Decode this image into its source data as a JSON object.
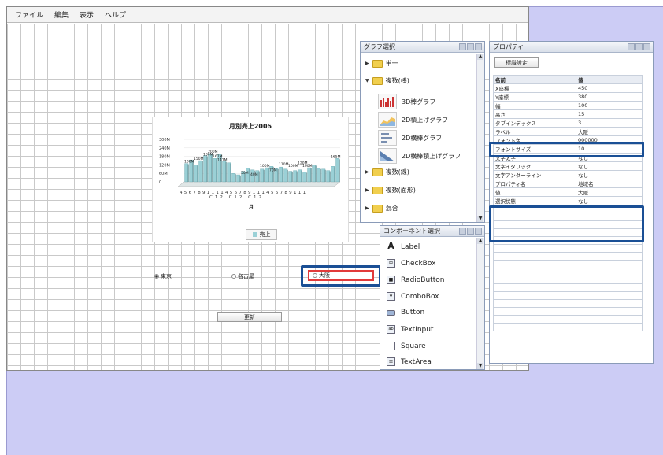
{
  "menu": [
    "ファイル",
    "編集",
    "表示",
    "ヘルプ"
  ],
  "chart_data": {
    "type": "bar",
    "title": "月別売上2005",
    "xlabel": "月",
    "yticks": [
      "300M",
      "240M",
      "180M",
      "120M",
      "60M",
      "0"
    ],
    "ylim": [
      0,
      300
    ],
    "categories": [
      "4",
      "5",
      "6",
      "7",
      "8",
      "9",
      "10",
      "11",
      "12",
      "1",
      "2",
      "3",
      "4",
      "5",
      "6",
      "7",
      "8",
      "9",
      "10",
      "11",
      "12",
      "1",
      "2",
      "3",
      "4",
      "5",
      "6",
      "7",
      "8",
      "9",
      "10",
      "11",
      "12"
    ],
    "values": [
      130,
      155,
      120,
      150,
      185,
      200,
      165,
      195,
      145,
      135,
      60,
      50,
      75,
      95,
      85,
      80,
      90,
      100,
      110,
      95,
      105,
      90,
      75,
      80,
      85,
      70,
      100,
      120,
      95,
      90,
      80,
      110,
      165
    ],
    "x_label_rows": {
      "row1": "4567891111456789111456789111",
      "row2": "C12  C12  C12"
    },
    "data_labels": [
      "100M",
      "150M",
      "180M",
      "200M",
      "167M",
      "141M",
      "50M",
      "40M",
      "100M",
      "70M",
      "110M",
      "100M",
      "120M",
      "100M",
      "165M"
    ],
    "legend": [
      "売上"
    ]
  },
  "canvas": {
    "radios": [
      {
        "label": "東京",
        "selected": true
      },
      {
        "label": "名古屋",
        "selected": false
      }
    ],
    "osaka_field": "大阪",
    "update_button": "更新"
  },
  "graph_panel": {
    "title": "グラフ選択",
    "items": [
      {
        "label": "単一",
        "kind": "folder",
        "expanded": false
      },
      {
        "label": "複数(棒)",
        "kind": "folder",
        "expanded": true
      },
      {
        "label": "3D棒グラフ",
        "kind": "chart"
      },
      {
        "label": "2D積上げグラフ",
        "kind": "chart"
      },
      {
        "label": "2D横棒グラフ",
        "kind": "chart"
      },
      {
        "label": "2D横棒積上げグラフ",
        "kind": "chart"
      },
      {
        "label": "複数(線)",
        "kind": "folder",
        "expanded": false
      },
      {
        "label": "複数(面形)",
        "kind": "folder",
        "expanded": false
      },
      {
        "label": "混合",
        "kind": "folder",
        "expanded": false
      }
    ]
  },
  "component_panel": {
    "title": "コンポーネント選択",
    "items": [
      {
        "label": "Label",
        "icon": "A"
      },
      {
        "label": "CheckBox",
        "icon": "☒"
      },
      {
        "label": "RadioButton",
        "icon": "■"
      },
      {
        "label": "ComboBox",
        "icon": "▾"
      },
      {
        "label": "Button",
        "icon": ""
      },
      {
        "label": "TextInput",
        "icon": "ab"
      },
      {
        "label": "Square",
        "icon": ""
      },
      {
        "label": "TextArea",
        "icon": "≡"
      }
    ]
  },
  "property_panel": {
    "title": "プロパティ",
    "button": "標識設定",
    "headers": [
      "名前",
      "値"
    ],
    "rows": [
      [
        "X座標",
        "450"
      ],
      [
        "Y座標",
        "380"
      ],
      [
        "幅",
        "100"
      ],
      [
        "高さ",
        "15"
      ],
      [
        "タブインデックス",
        "3"
      ],
      [
        "ラベル",
        "大阪"
      ],
      [
        "フォント色",
        "000000"
      ],
      [
        "フォントサイズ",
        "10"
      ],
      [
        "文字太字",
        "なし"
      ],
      [
        "文字イタリック",
        "なし"
      ],
      [
        "文字アンダーライン",
        "なし"
      ],
      [
        "プロパティ名",
        "地域名"
      ],
      [
        "値",
        "大阪"
      ],
      [
        "選択状態",
        "なし"
      ]
    ]
  },
  "colors": {
    "backdrop": "#ccccf5",
    "highlight_blue": "#1a4f95",
    "highlight_red": "#e23b3b",
    "bar": "#9ad0d6"
  }
}
